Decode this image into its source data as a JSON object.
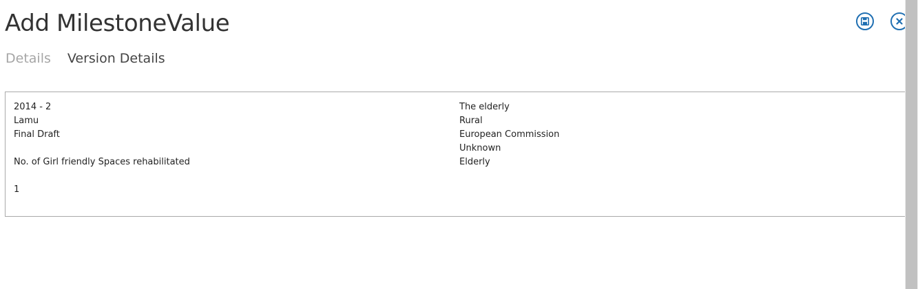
{
  "header": {
    "title": "Add MilestoneValue"
  },
  "tabs": [
    {
      "label": "Details",
      "state": "inactive"
    },
    {
      "label": "Version Details",
      "state": "active"
    }
  ],
  "actions": {
    "save_icon": "save-icon",
    "close_icon": "close-icon",
    "accent_color": "#1f6fb2"
  },
  "details": {
    "left": [
      "2014 - 2",
      "Lamu",
      "Final Draft",
      "",
      "No. of Girl friendly Spaces rehabilitated",
      "",
      "1"
    ],
    "right": [
      "The elderly",
      "Rural",
      "European Commission",
      "Unknown",
      "Elderly"
    ]
  }
}
